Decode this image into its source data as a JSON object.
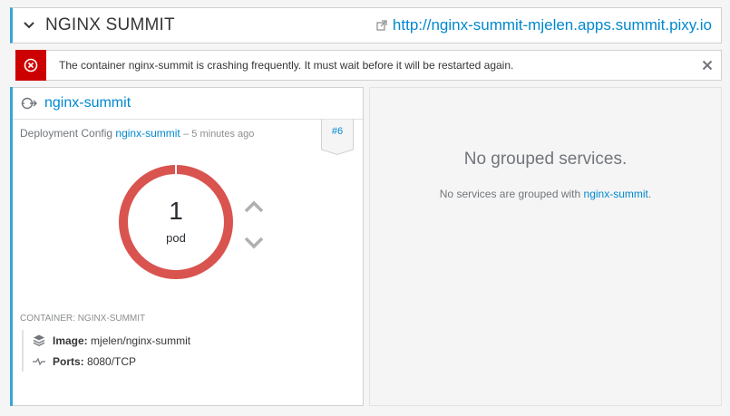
{
  "header": {
    "app_title": "NGINX SUMMIT",
    "route_url": "http://nginx-summit-mjelen.apps.summit.pixy.io"
  },
  "alert": {
    "message": "The container nginx-summit is crashing frequently. It must wait before it will be restarted again."
  },
  "deployment": {
    "name": "nginx-summit",
    "meta_label": "Deployment Config",
    "meta_name": "nginx-summit",
    "meta_ago": "– 5 minutes ago",
    "version_badge": "#6",
    "pod_count": "1",
    "pod_label": "pod",
    "container_label": "CONTAINER: NGINX-SUMMIT",
    "image_label": "Image:",
    "image_value": "mjelen/nginx-summit",
    "ports_label": "Ports:",
    "ports_value": "8080/TCP"
  },
  "grouped": {
    "title": "No grouped services.",
    "sub_prefix": "No services are grouped with",
    "sub_link": "nginx-summit",
    "sub_suffix": "."
  },
  "colors": {
    "accent": "#39a5dc",
    "link": "#0088ce",
    "danger": "#cc0000",
    "donut": "#d9534f"
  },
  "icons": {
    "collapse": "chevron-down-icon",
    "external_link": "external-link-icon",
    "alert": "error-circle-icon",
    "close": "close-icon",
    "deployment": "deployment-config-icon",
    "scale_up": "chevron-up-icon",
    "scale_down": "chevron-down-icon",
    "image": "layers-icon",
    "ports": "pulse-icon"
  }
}
